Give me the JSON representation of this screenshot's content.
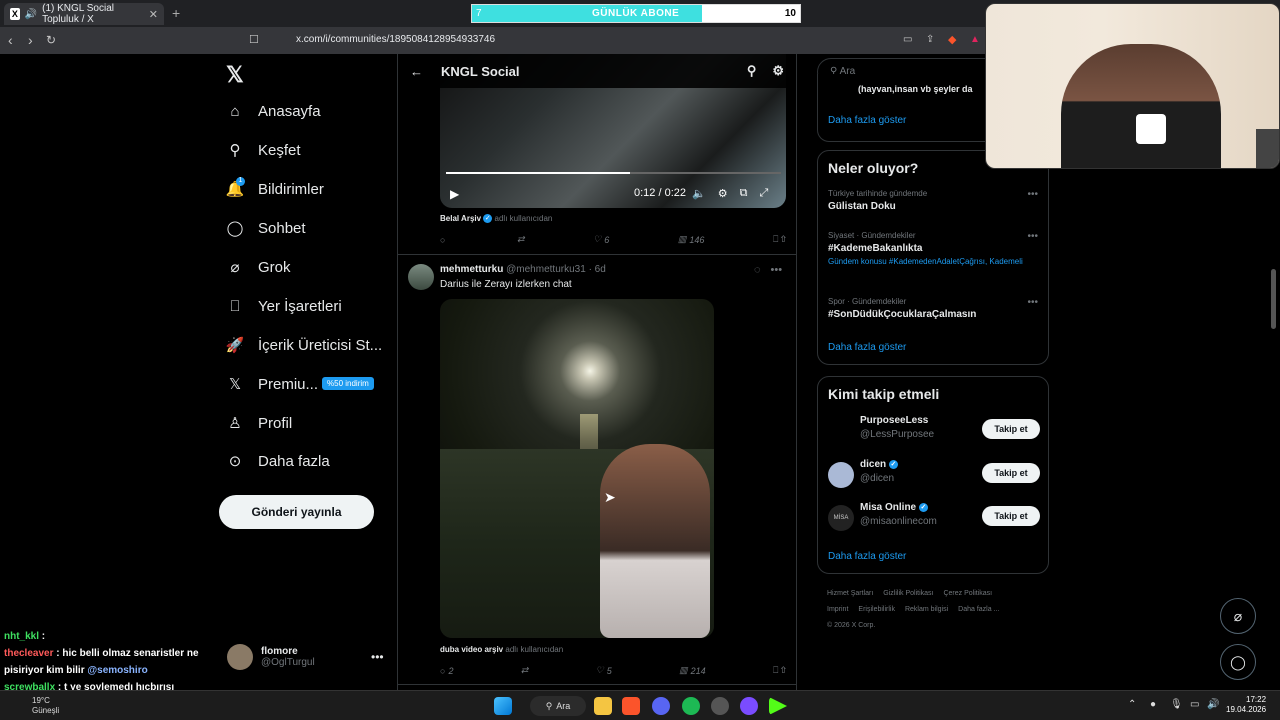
{
  "browser": {
    "tab_title": "(1) KNGL Social Topluluk / X",
    "tab_icon": "x-logo-icon",
    "url": "x.com/i/communities/1895084128954933746"
  },
  "sub_goal": {
    "current": "7",
    "label": "GÜNLÜK ABONE",
    "target": "10",
    "progress": 0.7
  },
  "sidebar": {
    "items": [
      {
        "label": "Anasayfa",
        "icon": "home-icon"
      },
      {
        "label": "Keşfet",
        "icon": "search-icon"
      },
      {
        "label": "Bildirimler",
        "icon": "bell-icon",
        "badge": "1"
      },
      {
        "label": "Sohbet",
        "icon": "chat-icon"
      },
      {
        "label": "Grok",
        "icon": "grok-icon"
      },
      {
        "label": "Yer İşaretleri",
        "icon": "bookmark-icon"
      },
      {
        "label": "İçerik Üreticisi St...",
        "icon": "rocket-icon"
      },
      {
        "label": "Premiu...",
        "icon": "x-logo-icon"
      },
      {
        "label": "Profil",
        "icon": "person-icon"
      },
      {
        "label": "Daha fazla",
        "icon": "more-circle-icon"
      }
    ],
    "premium_badge": "%50 indirim",
    "post_button": "Gönderi yayınla",
    "account": {
      "name": "flomore",
      "handle": "@OglTurgul"
    }
  },
  "timeline": {
    "title": "KNGL Social",
    "post1": {
      "video_time": "0:12 / 0:22",
      "video_progress": 0.55,
      "source_name": "Belal Arşiv",
      "source_suffix": "adlı kullanıcıdan",
      "replies": "",
      "reposts": "",
      "likes": "6",
      "views": "146"
    },
    "post2": {
      "name": "mehmetturku",
      "handle": "@mehmetturku31",
      "time": "· 6d",
      "text": "Darius ile Zerayı izlerken chat",
      "source_name": "duba video arşiv",
      "source_suffix": "adlı kullanıcıdan",
      "replies": "2",
      "reposts": "",
      "likes": "5",
      "views": "214"
    }
  },
  "right": {
    "search_placeholder": "Ara",
    "top_card_text": "(hayvan,insan vb şeyler da",
    "top_card_more": "Daha fazla göster",
    "trends_title": "Neler oluyor?",
    "trends": [
      {
        "meta": "Türkiye tarihinde gündemde",
        "name": "Gülistan Doku",
        "sub": ""
      },
      {
        "meta": "Siyaset · Gündemdekiler",
        "name": "#KademeBakanlıkta",
        "sub": "Gündem konusu #KademedenAdaletÇağrısı, Kademeli"
      },
      {
        "meta": "Spor · Gündemdekiler",
        "name": "#SonDüdükÇocuklaraÇalmasın",
        "sub": ""
      }
    ],
    "trends_more": "Daha fazla göster",
    "follow_title": "Kimi takip etmeli",
    "follow": [
      {
        "name": "PurposeeLess",
        "handle": "@LessPurposee",
        "verified": false,
        "button": "Takip et"
      },
      {
        "name": "dicen",
        "handle": "@dicen",
        "verified": true,
        "button": "Takip et"
      },
      {
        "name": "Misa Online",
        "handle": "@misaonlinecom",
        "verified": true,
        "button": "Takip et",
        "avatar_text": "MİSA"
      }
    ],
    "follow_more": "Daha fazla göster",
    "footer": [
      "Hizmet Şartları",
      "Gizlilik Politikası",
      "Çerez Politikası",
      "Imprint",
      "Erişilebilirlik",
      "Reklam bilgisi",
      "Daha fazla ...",
      "© 2026 X Corp."
    ]
  },
  "chat": [
    {
      "user": "nht_kkl",
      "msg": ""
    },
    {
      "user": "thecleaver",
      "msg": "hic belli olmaz senaristler ne pisiriyor kim bilir",
      "mention": "@semoshiro"
    },
    {
      "user": "screwballx",
      "msg": "t ye soylemedı hıcbırısı"
    },
    {
      "user": "nht_kkl",
      "msg": ""
    }
  ],
  "taskbar": {
    "search_label": "Ara",
    "weather_temp": "19°C",
    "weather_desc": "Güneşli",
    "time": "17:22",
    "date": "19.04.2026"
  }
}
